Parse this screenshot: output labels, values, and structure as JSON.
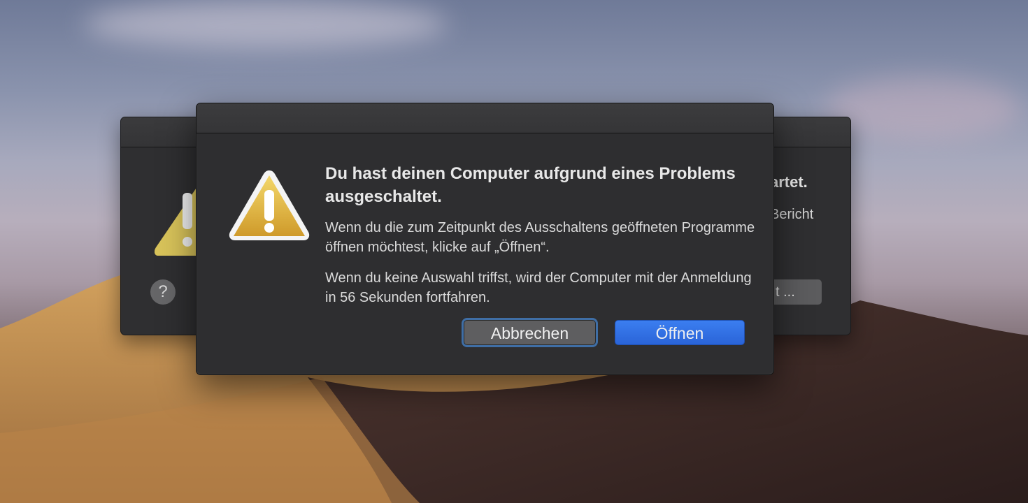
{
  "dialog": {
    "title": "Du hast deinen Computer aufgrund eines Problems ausgeschaltet.",
    "message1": "Wenn du die zum Zeitpunkt des Ausschaltens geöffneten Programme öffnen möchtest, klicke auf „Öffnen“.",
    "message2": "Wenn du keine Auswahl triffst, wird der Computer mit der Anmeldung in 56 Sekunden fortfahren.",
    "cancel_label": "Abbrechen",
    "open_label": "Öffnen",
    "icon": "warning-icon"
  },
  "background_dialog": {
    "title_fragment": "artet.",
    "text_fragment": "Bericht",
    "button_fragment": "t ...",
    "help_label": "?",
    "icon": "warning-icon"
  },
  "colors": {
    "primary_button": "#2a64d8",
    "focus_ring": "#3f6ea5",
    "dialog_bg": "#2e2e30",
    "warning_yellow": "#e5b93c"
  }
}
